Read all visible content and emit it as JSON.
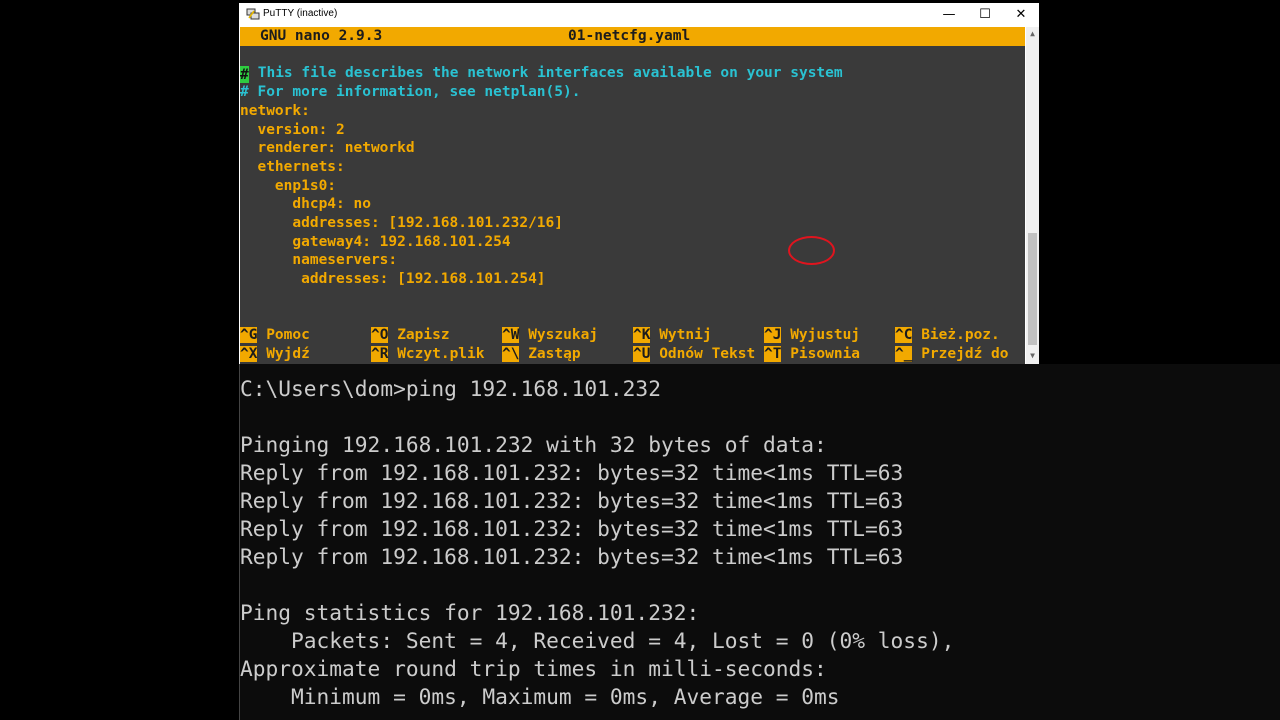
{
  "window": {
    "title": "PuTTY (inactive)",
    "minimize": "—",
    "maximize": "☐",
    "close": "✕"
  },
  "nano": {
    "version": "GNU nano 2.9.3",
    "filename": "01-netcfg.yaml",
    "cursor_char": "#",
    "lines": [
      " This file describes the network interfaces available on your system",
      "# For more information, see netplan(5).",
      "network:",
      "  version: 2",
      "  renderer: networkd",
      "  ethernets:",
      "    enp1s0:",
      "      dhcp4: no",
      "      addresses: [192.168.101.232/16]",
      "      gateway4: 192.168.101.254",
      "      nameservers:",
      "       addresses: [192.168.101.254]"
    ],
    "shortcuts_row1": [
      {
        "key": "^G",
        "label": "Pomoc"
      },
      {
        "key": "^O",
        "label": "Zapisz"
      },
      {
        "key": "^W",
        "label": "Wyszukaj"
      },
      {
        "key": "^K",
        "label": "Wytnij"
      },
      {
        "key": "^J",
        "label": "Wyjustuj"
      },
      {
        "key": "^C",
        "label": "Bież.poz."
      }
    ],
    "shortcuts_row2": [
      {
        "key": "^X",
        "label": "Wyjdź"
      },
      {
        "key": "^R",
        "label": "Wczyt.plik"
      },
      {
        "key": "^\\",
        "label": "Zastąp"
      },
      {
        "key": "^U",
        "label": "Odnów Tekst"
      },
      {
        "key": "^T",
        "label": "Pisownia"
      },
      {
        "key": "^_",
        "label": "Przejdź do"
      }
    ]
  },
  "scrollbar": {
    "up": "▲",
    "down": "▼"
  },
  "cmd": {
    "lines": [
      "C:\\Users\\dom>ping 192.168.101.232",
      "",
      "Pinging 192.168.101.232 with 32 bytes of data:",
      "Reply from 192.168.101.232: bytes=32 time<1ms TTL=63",
      "Reply from 192.168.101.232: bytes=32 time<1ms TTL=63",
      "Reply from 192.168.101.232: bytes=32 time<1ms TTL=63",
      "Reply from 192.168.101.232: bytes=32 time<1ms TTL=63",
      "",
      "Ping statistics for 192.168.101.232:",
      "    Packets: Sent = 4, Received = 4, Lost = 0 (0% loss),",
      "Approximate round trip times in milli-seconds:",
      "    Minimum = 0ms, Maximum = 0ms, Average = 0ms"
    ]
  }
}
